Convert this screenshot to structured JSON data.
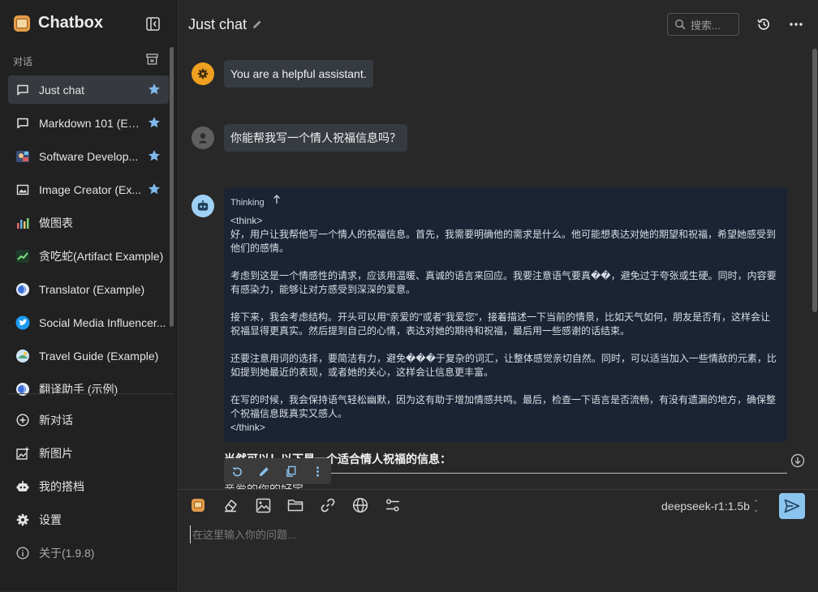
{
  "app": {
    "name": "Chatbox"
  },
  "sidebar": {
    "section_label": "对话",
    "sessions": [
      {
        "label": "Just chat",
        "icon": "chat-bubble-icon",
        "starred": true,
        "active": true
      },
      {
        "label": "Markdown 101 (Ex...",
        "icon": "chat-bubble-icon",
        "starred": true
      },
      {
        "label": "Software Develop...",
        "icon": "software-avatar-icon",
        "starred": true
      },
      {
        "label": "Image Creator (Ex...",
        "icon": "image-icon",
        "starred": true
      },
      {
        "label": "做图表",
        "icon": "bar-chart-avatar-icon"
      },
      {
        "label": "贪吃蛇(Artifact Example)",
        "icon": "snake-game-avatar-icon"
      },
      {
        "label": "Translator (Example)",
        "icon": "translator-avatar-icon"
      },
      {
        "label": "Social Media Influencer...",
        "icon": "twitter-avatar-icon"
      },
      {
        "label": "Travel Guide (Example)",
        "icon": "travel-avatar-icon"
      },
      {
        "label": "翻译助手 (示例)",
        "icon": "translator-avatar-icon"
      }
    ],
    "nav": [
      {
        "label": "新对话",
        "icon": "plus-circle-icon"
      },
      {
        "label": "新图片",
        "icon": "image-add-icon"
      },
      {
        "label": "我的搭档",
        "icon": "robot-icon"
      },
      {
        "label": "设置",
        "icon": "gear-icon"
      },
      {
        "label": "关于(1.9.8)",
        "icon": "info-icon"
      }
    ]
  },
  "header": {
    "title": "Just chat",
    "search_placeholder": "搜索..."
  },
  "messages": {
    "system": "You are a helpful assistant.",
    "user": "你能帮我写一个情人祝福信息吗？",
    "thinking_label": "Thinking",
    "thinking_lines": [
      "<think>",
      "好，用户让我帮他写一个情人的祝福信息。首先，我需要明确他的需求是什么。他可能想表达对她的期望和祝福，希望她感受到他们的感情。",
      "考虑到这是一个情感性的请求，应该用温暖、真诚的语言来回应。我要注意语气要真��，避免过于夸张或生硬。同时，内容要有感染力，能够让对方感受到深深的爱意。",
      "接下来，我会考虑结构。开头可以用\"亲爱的\"或者\"我爱您\"，接着描述一下当前的情景，比如天气如何，朋友是否有，这样会让祝福显得更真实。然后提到自己的心情，表达对她的期待和祝福，最后用一些感谢的话结束。",
      "还要注意用词的选择，要简洁有力，避免���于复杂的词汇，让整体感觉亲切自然。同时，可以适当加入一些情敌的元素，比如提到她最近的表现，或者她的关心，这样会让信息更丰富。",
      "在写的时候，我会保持语气轻松幽默，因为这有助于增加情感共鸣。最后，检查一下语言是否流畅，有没有遗漏的地方，确保整个祝福信息既真实又感人。",
      "</think>"
    ],
    "answer_heading": "当然可以！以下是一个适合情人祝福的信息：",
    "answer_next": "亲爱的你的好宝"
  },
  "input": {
    "placeholder": "在这里输入你的问题...",
    "model": "deepseek-r1:1.5b"
  },
  "colors": {
    "accent": "#8cc4f0",
    "star": "#7fb8ec",
    "thinking_bg": "#1b2434"
  }
}
